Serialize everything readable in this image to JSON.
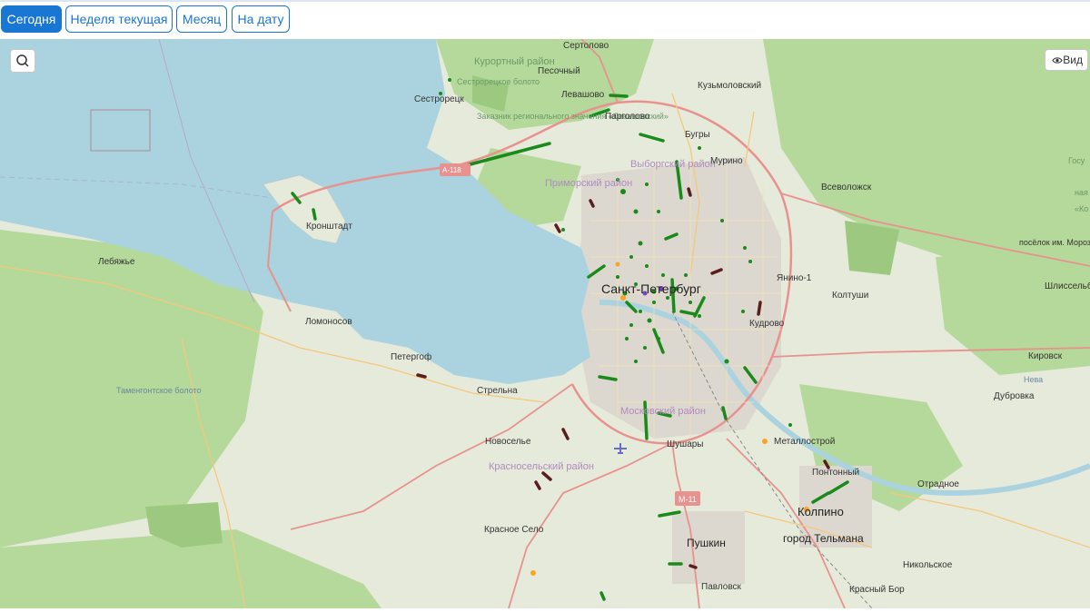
{
  "tabs": [
    {
      "label": "Сегодня",
      "active": true
    },
    {
      "label": "Неделя текущая",
      "active": false
    },
    {
      "label": "Месяц",
      "active": false
    },
    {
      "label": "На дату",
      "active": false
    }
  ],
  "map": {
    "view_button_label": "Вид",
    "icons": {
      "search": "search-icon",
      "view": "eye-icon",
      "airport": "airplane-icon"
    },
    "colors": {
      "water": "#aad3df",
      "land": "#e9e7dc",
      "forest": "#a8d08a",
      "road_primary": "#e8928f",
      "road_secondary": "#f5c77e",
      "marker_green": "#1a8a1a",
      "marker_dark": "#5a1e1e",
      "marker_orange": "#f5a623"
    },
    "labels": {
      "sertolovo": "Сертолово",
      "kurortny": "Курортный район",
      "sestroretsk": "Сестрорецк",
      "pesochny": "Песочный",
      "sestroretskoe_boloto": "Сестрорецкое болото",
      "levashovo": "Левашово",
      "kuzmolovsky": "Кузьмоловский",
      "zakaznik": "Заказник регионального значения «Левашовский»",
      "pargolovo": "Парголово",
      "bugry": "Бугры",
      "vyborgsky": "Выборгский район",
      "murino": "Мурино",
      "primorsky": "Приморский район",
      "vsevolozhsk": "Всеволожск",
      "kronshtadt": "Кронштадт",
      "a118": "А-118",
      "lebyazhye": "Лебяжье",
      "spb": "Санкт-Петербург",
      "yanino": "Янино-1",
      "koltushi": "Колтуши",
      "lomonosov": "Ломоносов",
      "kudrovo": "Кудрово",
      "petergof": "Петергоф",
      "kirovsk": "Кировск",
      "strelna": "Стрельна",
      "dubrovka": "Дубровка",
      "tamengont": "Таменгонтское болото",
      "moskovsky": "Московский район",
      "novoselye": "Новоселье",
      "shushary": "Шушары",
      "metallostroy": "Металлострой",
      "krasnoselsky": "Красносельский район",
      "pontonny": "Понтонный",
      "otradnoe": "Отрадное",
      "m11": "М-11",
      "kolpino": "Колпино",
      "krasnoe_selo": "Красное Село",
      "pushkin": "Пушкин",
      "telmana": "город Тельмана",
      "nikolskoe": "Никольское",
      "pavlovsk": "Павловск",
      "krasny_bor": "Красный Бор",
      "posyolok_morozova": "посёлок им. Морозова",
      "shlisselburg": "Шлиссельбург",
      "neva": "Нева",
      "right_edge_1": "Госу",
      "right_edge_2": "ная",
      "right_edge_3": "«Ко"
    }
  }
}
